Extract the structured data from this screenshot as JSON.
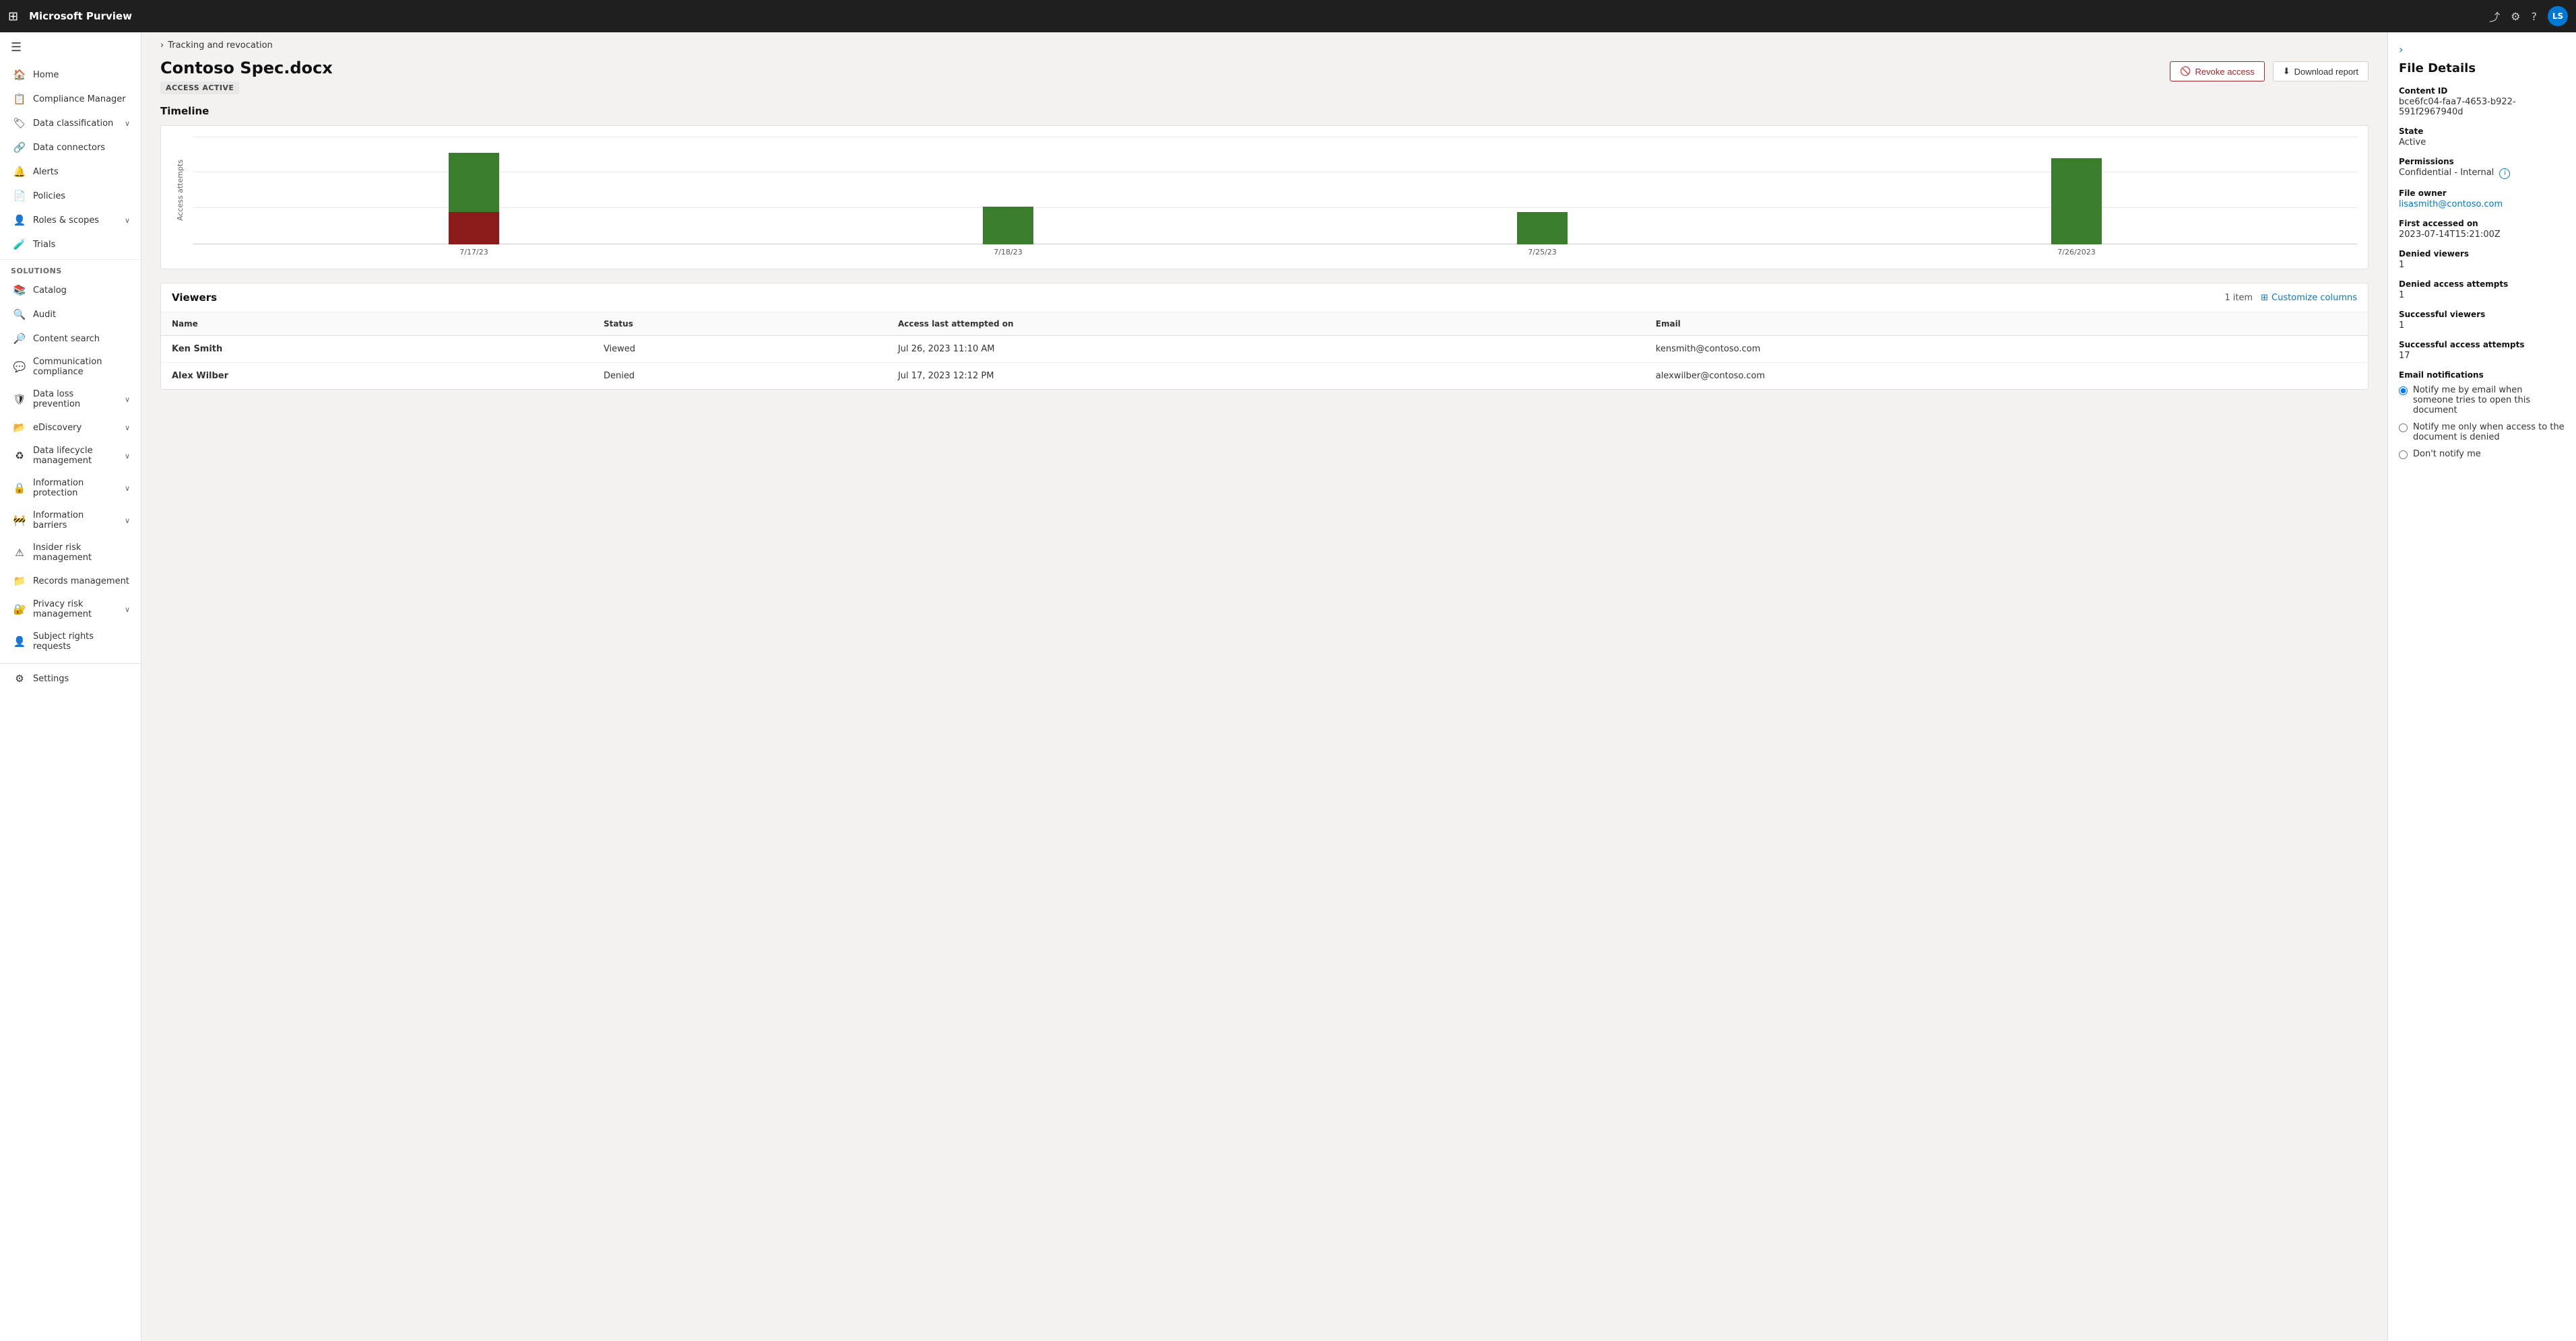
{
  "app": {
    "name": "Microsoft Purview",
    "avatar": "LS"
  },
  "topnav": {
    "share_icon": "⤴",
    "settings_icon": "⚙",
    "help_icon": "?",
    "avatar": "LS"
  },
  "sidebar": {
    "toggle_icon": "☰",
    "items": [
      {
        "id": "home",
        "label": "Home",
        "icon": "🏠",
        "hasChevron": false
      },
      {
        "id": "compliance-manager",
        "label": "Compliance Manager",
        "icon": "📋",
        "hasChevron": false
      },
      {
        "id": "data-classification",
        "label": "Data classification",
        "icon": "🏷",
        "hasChevron": true
      },
      {
        "id": "data-connectors",
        "label": "Data connectors",
        "icon": "🔗",
        "hasChevron": false
      },
      {
        "id": "alerts",
        "label": "Alerts",
        "icon": "🔔",
        "hasChevron": false
      },
      {
        "id": "policies",
        "label": "Policies",
        "icon": "📄",
        "hasChevron": false
      },
      {
        "id": "roles-scopes",
        "label": "Roles & scopes",
        "icon": "👤",
        "hasChevron": true
      }
    ],
    "items2": [
      {
        "id": "trials",
        "label": "Trials",
        "icon": "🧪",
        "hasChevron": false
      }
    ],
    "section_solutions": "Solutions",
    "solutions": [
      {
        "id": "catalog",
        "label": "Catalog",
        "icon": "📚",
        "hasChevron": false
      },
      {
        "id": "audit",
        "label": "Audit",
        "icon": "🔍",
        "hasChevron": false
      },
      {
        "id": "content-search",
        "label": "Content search",
        "icon": "🔎",
        "hasChevron": false
      },
      {
        "id": "communication-compliance",
        "label": "Communication compliance",
        "icon": "💬",
        "hasChevron": false
      },
      {
        "id": "data-loss-prevention",
        "label": "Data loss prevention",
        "icon": "🛡",
        "hasChevron": true
      },
      {
        "id": "ediscovery",
        "label": "eDiscovery",
        "icon": "📂",
        "hasChevron": true
      },
      {
        "id": "data-lifecycle",
        "label": "Data lifecycle management",
        "icon": "♻",
        "hasChevron": true
      },
      {
        "id": "information-protection",
        "label": "Information protection",
        "icon": "🔒",
        "hasChevron": true
      },
      {
        "id": "information-barriers",
        "label": "Information barriers",
        "icon": "🚧",
        "hasChevron": true
      },
      {
        "id": "insider-risk",
        "label": "Insider risk management",
        "icon": "⚠",
        "hasChevron": false
      },
      {
        "id": "records-management",
        "label": "Records management",
        "icon": "📁",
        "hasChevron": false
      },
      {
        "id": "privacy-risk",
        "label": "Privacy risk management",
        "icon": "🔐",
        "hasChevron": true
      },
      {
        "id": "subject-rights",
        "label": "Subject rights requests",
        "icon": "👤",
        "hasChevron": false
      }
    ],
    "settings_label": "Settings",
    "settings_icon": "⚙"
  },
  "breadcrumb": {
    "chevron": "›",
    "label": "Tracking and revocation"
  },
  "header": {
    "title": "Contoso Spec.docx",
    "badge": "ACCESS ACTIVE",
    "revoke_label": "Revoke access",
    "revoke_icon": "🚫",
    "download_label": "Download report",
    "download_icon": "⬇"
  },
  "timeline": {
    "title": "Timeline",
    "y_axis_label": "Access attempts",
    "bars": [
      {
        "date": "7/17/23",
        "green": 55,
        "red": 30
      },
      {
        "date": "7/18/23",
        "green": 35,
        "red": 0
      },
      {
        "date": "7/25/23",
        "green": 30,
        "red": 0
      },
      {
        "date": "7/26/23",
        "green": 80,
        "red": 0
      }
    ]
  },
  "viewers": {
    "title": "Viewers",
    "item_count": "1 item",
    "customize_label": "Customize columns",
    "customize_icon": "⊞",
    "columns": [
      "Name",
      "Status",
      "Access last attempted on",
      "Email"
    ],
    "rows": [
      {
        "name": "Ken Smith",
        "status": "Viewed",
        "access_date": "Jul 26, 2023 11:10 AM",
        "email": "kensmith@contoso.com"
      },
      {
        "name": "Alex Wilber",
        "status": "Denied",
        "access_date": "Jul 17, 2023 12:12 PM",
        "email": "alexwilber@contoso.com"
      }
    ]
  },
  "file_details": {
    "panel_title": "File Details",
    "panel_toggle": "›",
    "content_id_label": "Content ID",
    "content_id_value": "bce6fc04-faa7-4653-b922-591f2967940d",
    "state_label": "State",
    "state_value": "Active",
    "permissions_label": "Permissions",
    "permissions_value": "Confidential - Internal",
    "file_owner_label": "File owner",
    "file_owner_value": "lisasmith@contoso.com",
    "first_accessed_label": "First accessed on",
    "first_accessed_value": "2023-07-14T15:21:00Z",
    "denied_viewers_label": "Denied viewers",
    "denied_viewers_value": "1",
    "denied_access_label": "Denied access attempts",
    "denied_access_value": "1",
    "successful_viewers_label": "Successful viewers",
    "successful_viewers_value": "1",
    "successful_access_label": "Successful access attempts",
    "successful_access_value": "17",
    "email_notif_label": "Email notifications",
    "notif_option1": "Notify me by email when someone tries to open this document",
    "notif_option2": "Notify me only when access to the document is denied",
    "notif_option3": "Don't notify me"
  }
}
